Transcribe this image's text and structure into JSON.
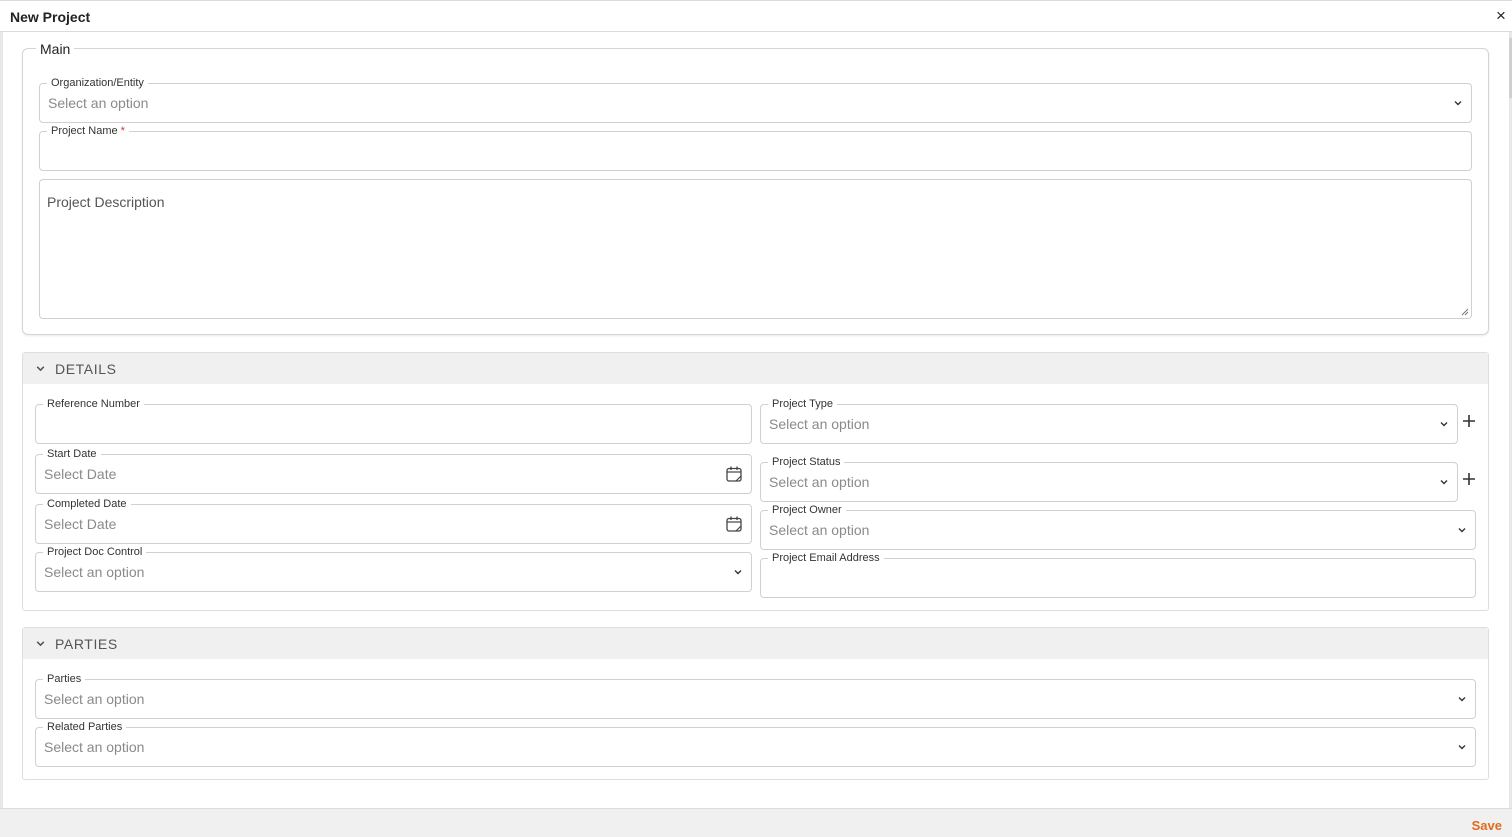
{
  "dialog": {
    "title": "New Project",
    "close_glyph": "×"
  },
  "main": {
    "legend": "Main",
    "organization": {
      "label": "Organization/Entity",
      "placeholder": "Select an option"
    },
    "project_name": {
      "label": "Project Name",
      "required_mark": "*",
      "value": ""
    },
    "project_description": {
      "placeholder": "Project Description"
    }
  },
  "details": {
    "title": "DETAILS",
    "reference_number": {
      "label": "Reference Number",
      "value": ""
    },
    "start_date": {
      "label": "Start Date",
      "placeholder": "Select Date"
    },
    "completed_date": {
      "label": "Completed Date",
      "placeholder": "Select Date"
    },
    "doc_control": {
      "label": "Project Doc Control",
      "placeholder": "Select an option"
    },
    "project_type": {
      "label": "Project Type",
      "placeholder": "Select an option"
    },
    "project_status": {
      "label": "Project Status",
      "placeholder": "Select an option"
    },
    "project_owner": {
      "label": "Project Owner",
      "placeholder": "Select an option"
    },
    "email": {
      "label": "Project Email Address",
      "value": ""
    }
  },
  "parties": {
    "title": "PARTIES",
    "parties": {
      "label": "Parties",
      "placeholder": "Select an option"
    },
    "related_parties": {
      "label": "Related Parties",
      "placeholder": "Select an option"
    }
  },
  "footer": {
    "save_label": "Save"
  },
  "colors": {
    "accent": "#e06a1f",
    "border": "#d0d0d0",
    "section_header": "#f0f0f0"
  },
  "icons": [
    "close-icon",
    "chevron-down-icon",
    "calendar-icon",
    "plus-icon",
    "resize-grip-icon"
  ]
}
